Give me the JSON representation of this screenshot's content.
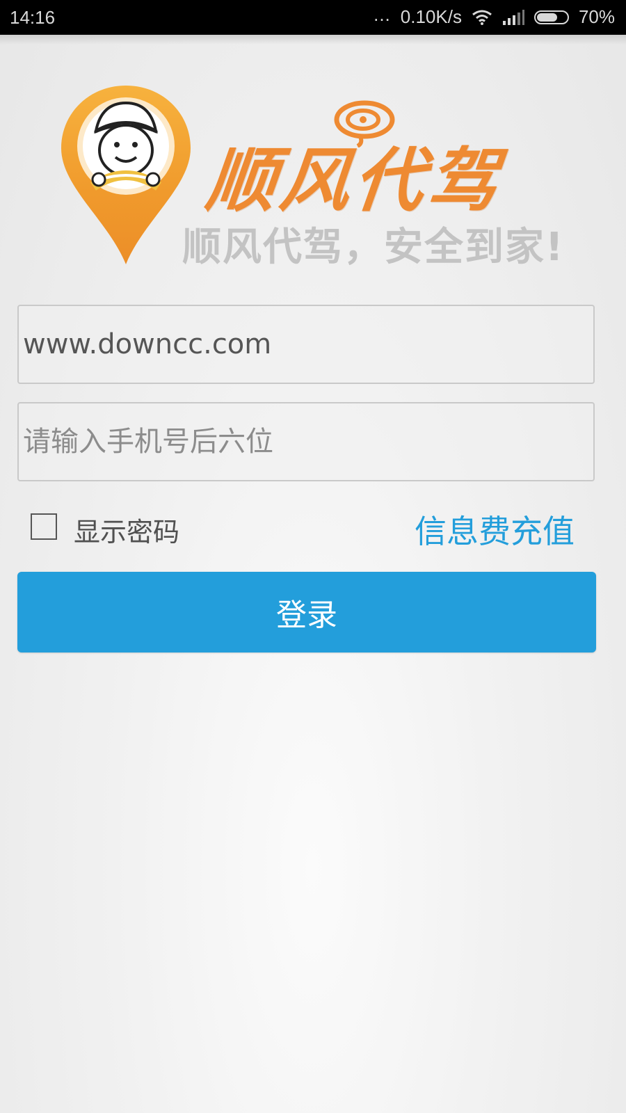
{
  "status_bar": {
    "time": "14:16",
    "dots": "...",
    "network_speed": "0.10K/s",
    "battery_percent": "70%",
    "battery_level": 0.7
  },
  "logo": {
    "script_text": "顺风代驾",
    "slogan": "顺风代驾，安全到家!",
    "colors": {
      "pin": "#f0a030",
      "script": "#ee8a32",
      "slogan": "#c3c3c3"
    }
  },
  "form": {
    "username_value": "www.downcc.com",
    "password_placeholder": "请输入手机号后六位",
    "show_password_label": "显示密码",
    "show_password_checked": false,
    "recharge_link": "信息费充值",
    "login_button": "登录"
  },
  "colors": {
    "accent": "#239edb",
    "status_bar": "#000000"
  },
  "icons": [
    "wifi-icon",
    "signal-icon",
    "battery-icon",
    "map-pin-driver-icon",
    "swirl-cloud-icon"
  ]
}
